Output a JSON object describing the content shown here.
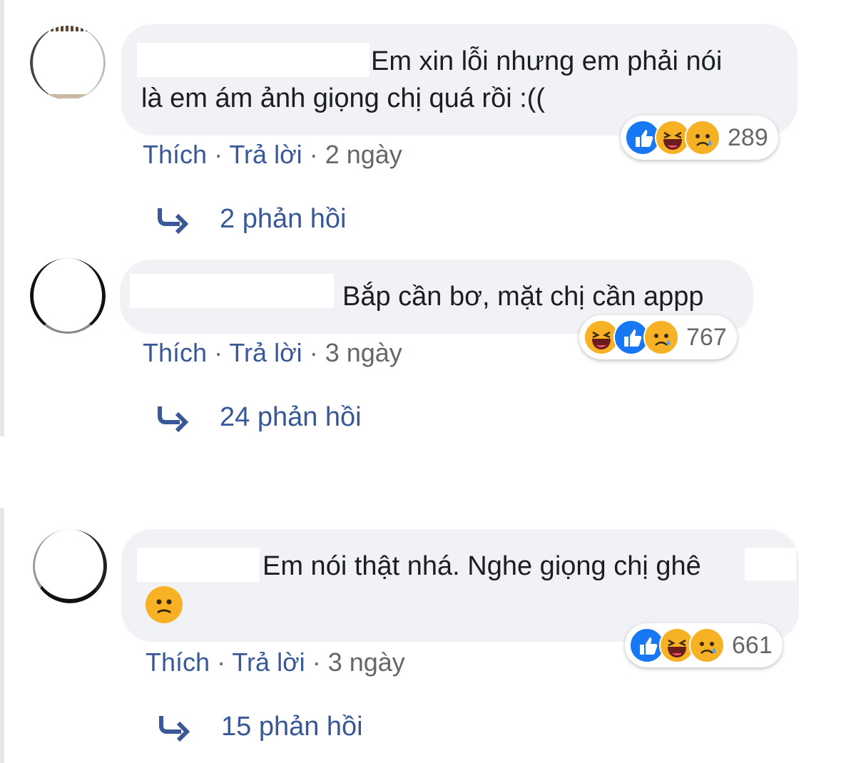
{
  "comments": [
    {
      "text_line1": "Em xin lỗi nhưng em phải nói",
      "text_line2": "là em ám ảnh giọng chị quá rồi :((",
      "reaction_count": "289",
      "reactions": [
        "like-icon",
        "haha-icon",
        "sad-icon"
      ],
      "like": "Thích",
      "reply": "Trả lời",
      "time": "2 ngày",
      "replies": "2 phản hồi"
    },
    {
      "text_line1": "Bắp cần bơ, mặt chị cần appp",
      "reaction_count": "767",
      "reactions": [
        "haha-icon",
        "like-icon",
        "sad-icon"
      ],
      "like": "Thích",
      "reply": "Trả lời",
      "time": "3 ngày",
      "replies": "24 phản hồi"
    },
    {
      "text_line1": "Em nói thật nhá. Nghe giọng chị ghê",
      "emoji": "😕",
      "reaction_count": "661",
      "reactions": [
        "like-icon",
        "haha-icon",
        "sad-icon"
      ],
      "like": "Thích",
      "reply": "Trả lời",
      "time": "3 ngày",
      "replies": "15 phản hồi"
    }
  ],
  "colors": {
    "bubble": "#f0f2f5",
    "link": "#385898",
    "meta": "#65676b",
    "like": "#1877f2",
    "emoji": "#f7b125"
  }
}
